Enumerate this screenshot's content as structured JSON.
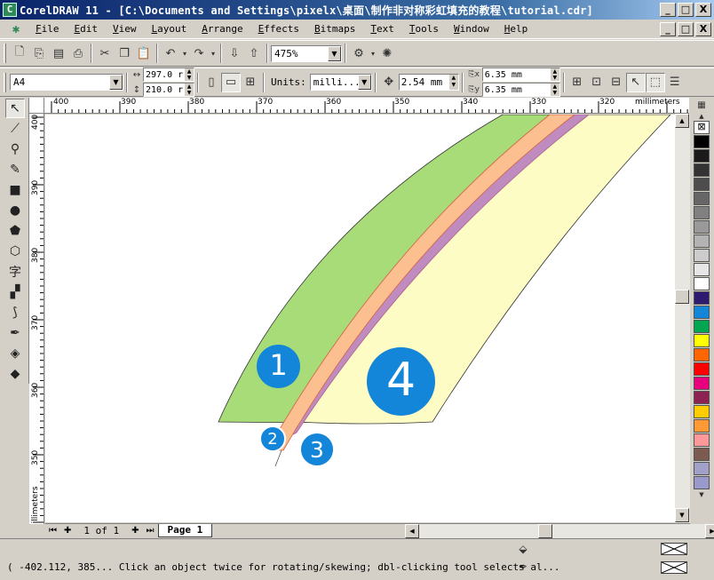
{
  "window": {
    "title": "CorelDRAW 11 - [C:\\Documents and Settings\\pixelx\\桌面\\制作非对称彩虹填充的教程\\tutorial.cdr]",
    "minimize": "_",
    "restore": "□",
    "close": "X"
  },
  "menu": [
    {
      "ul": "F",
      "rest": "ile"
    },
    {
      "ul": "E",
      "rest": "dit"
    },
    {
      "ul": "V",
      "rest": "iew"
    },
    {
      "ul": "L",
      "rest": "ayout"
    },
    {
      "ul": "A",
      "rest": "rrange"
    },
    {
      "ul": "E",
      "rest": "ffects"
    },
    {
      "ul": "B",
      "rest": "itmaps"
    },
    {
      "ul": "T",
      "rest": "ext"
    },
    {
      "ul": "T",
      "rest": "ools"
    },
    {
      "ul": "W",
      "rest": "indow"
    },
    {
      "ul": "H",
      "rest": "elp"
    }
  ],
  "doc_buttons": {
    "minimize": "_",
    "restore": "□",
    "close": "X"
  },
  "standard_toolbar": {
    "zoom_level": "475%"
  },
  "property_bar": {
    "paper_size": "A4",
    "width": "297.0 r",
    "height": "210.0 r",
    "units_label": "Units:",
    "units_value": "milli...",
    "nudge": "2.54 mm",
    "dup_x": "6.35 mm",
    "dup_y": "6.35 mm"
  },
  "ruler_h": {
    "unit": "millimeters",
    "ticks": [
      "400",
      "390",
      "380",
      "370",
      "360",
      "350",
      "340",
      "330",
      "320"
    ]
  },
  "ruler_v": {
    "unit": "millimeters",
    "ticks": [
      "400",
      "390",
      "380",
      "370",
      "360",
      "350"
    ]
  },
  "badges": [
    "1",
    "2",
    "3",
    "4"
  ],
  "palette": [
    "#000000",
    "#1a1a1a",
    "#333333",
    "#4d4d4d",
    "#666666",
    "#808080",
    "#999999",
    "#b3b3b3",
    "#cccccc",
    "#e6e6e6",
    "#ffffff",
    "#2e1a6e",
    "#1486d9",
    "#00a650",
    "#ffff00",
    "#ff6600",
    "#ff0000",
    "#e6007e",
    "#8b2252",
    "#ffcc00",
    "#ff9933",
    "#ff9999",
    "#7d5a50",
    "#a0a0c8",
    "#9999cc"
  ],
  "page_nav": {
    "count": "1 of 1",
    "tab": "Page 1"
  },
  "status": {
    "text": "( -402.112, 385... Click an object twice for rotating/skewing; dbl-clicking tool selects al..."
  }
}
